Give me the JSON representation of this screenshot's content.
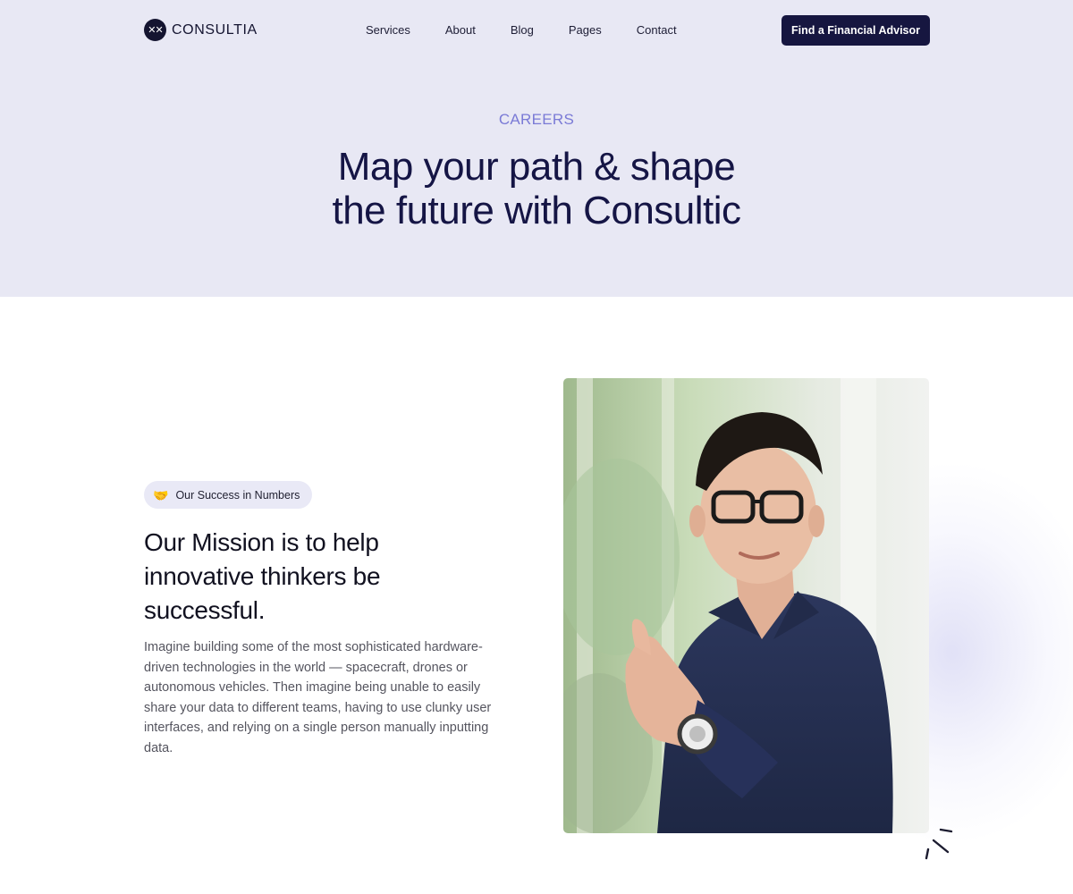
{
  "nav": {
    "logo_text": "CONSULTIA",
    "links": [
      "Services",
      "About",
      "Blog",
      "Pages",
      "Contact"
    ],
    "cta_label": "Find a Financial Advisor"
  },
  "hero": {
    "eyebrow": "CAREERS",
    "title_line1": "Map your path & shape",
    "title_line2": "the future with Consultic"
  },
  "mission": {
    "badge_icon": "🤝",
    "badge_text": "Our Success in Numbers",
    "title": "Our Mission is to help innovative thinkers be successful.",
    "body": "Imagine building some of the most sophisticated hardware-driven technologies in the world — spacecraft, drones or autonomous vehicles. Then imagine being unable to easily share your data to different teams, having to use clunky user interfaces, and relying on a single person manually inputting data."
  },
  "colors": {
    "hero_bg": "#e8e8f4",
    "navy": "#161640",
    "accent": "#7a7ad6",
    "shirt": "#273257"
  }
}
